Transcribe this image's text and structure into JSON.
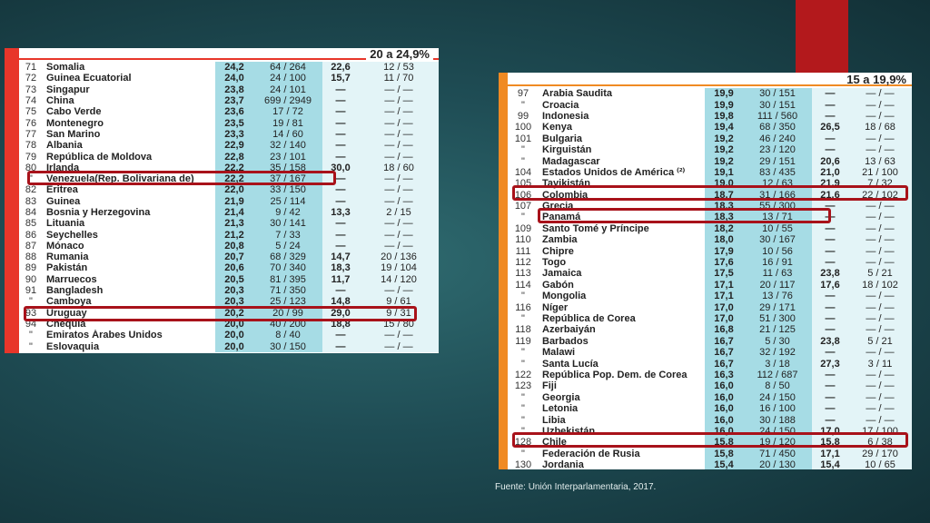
{
  "left_table": {
    "header": "20 a 24,9%",
    "rows": [
      {
        "rank": "71",
        "country": "Somalia",
        "pct": "24,2",
        "seats": "64 / 264",
        "pct2": "22,6",
        "seats2": "12 / 53"
      },
      {
        "rank": "72",
        "country": "Guinea Ecuatorial",
        "pct": "24,0",
        "seats": "24 / 100",
        "pct2": "15,7",
        "seats2": "11 / 70"
      },
      {
        "rank": "73",
        "country": "Singapur",
        "pct": "23,8",
        "seats": "24 / 101",
        "pct2": "—",
        "seats2": "— / —"
      },
      {
        "rank": "74",
        "country": "China",
        "pct": "23,7",
        "seats": "699 / 2949",
        "pct2": "—",
        "seats2": "— / —"
      },
      {
        "rank": "75",
        "country": "Cabo Verde",
        "pct": "23,6",
        "seats": "17 / 72",
        "pct2": "—",
        "seats2": "— / —"
      },
      {
        "rank": "76",
        "country": "Montenegro",
        "pct": "23,5",
        "seats": "19 / 81",
        "pct2": "—",
        "seats2": "— / —"
      },
      {
        "rank": "77",
        "country": "San Marino",
        "pct": "23,3",
        "seats": "14 / 60",
        "pct2": "—",
        "seats2": "— / —"
      },
      {
        "rank": "78",
        "country": "Albania",
        "pct": "22,9",
        "seats": "32 / 140",
        "pct2": "—",
        "seats2": "— / —"
      },
      {
        "rank": "79",
        "country": "República de Moldova",
        "pct": "22,8",
        "seats": "23 / 101",
        "pct2": "—",
        "seats2": "— / —"
      },
      {
        "rank": "80",
        "country": "Irlanda",
        "pct": "22,2",
        "seats": "35 / 158",
        "pct2": "30,0",
        "seats2": "18 / 60"
      },
      {
        "rank": "\"",
        "country": "Venezuela(Rep. Bolivariana de)",
        "pct": "22,2",
        "seats": "37 / 167",
        "pct2": "—",
        "seats2": "— / —"
      },
      {
        "rank": "82",
        "country": "Eritrea",
        "pct": "22,0",
        "seats": "33 / 150",
        "pct2": "—",
        "seats2": "— / —"
      },
      {
        "rank": "83",
        "country": "Guinea",
        "pct": "21,9",
        "seats": "25 / 114",
        "pct2": "—",
        "seats2": "— / —"
      },
      {
        "rank": "84",
        "country": "Bosnia y Herzegovina",
        "pct": "21,4",
        "seats": "9 / 42",
        "pct2": "13,3",
        "seats2": "2 / 15"
      },
      {
        "rank": "85",
        "country": "Lituania",
        "pct": "21,3",
        "seats": "30 / 141",
        "pct2": "—",
        "seats2": "— / —"
      },
      {
        "rank": "86",
        "country": "Seychelles",
        "pct": "21,2",
        "seats": "7 / 33",
        "pct2": "—",
        "seats2": "— / —"
      },
      {
        "rank": "87",
        "country": "Mónaco",
        "pct": "20,8",
        "seats": "5 / 24",
        "pct2": "—",
        "seats2": "— / —"
      },
      {
        "rank": "88",
        "country": "Rumania",
        "pct": "20,7",
        "seats": "68 / 329",
        "pct2": "14,7",
        "seats2": "20 / 136"
      },
      {
        "rank": "89",
        "country": "Pakistán",
        "pct": "20,6",
        "seats": "70 / 340",
        "pct2": "18,3",
        "seats2": "19 / 104"
      },
      {
        "rank": "90",
        "country": "Marruecos",
        "pct": "20,5",
        "seats": "81 / 395",
        "pct2": "11,7",
        "seats2": "14 / 120"
      },
      {
        "rank": "91",
        "country": "Bangladesh",
        "pct": "20,3",
        "seats": "71 / 350",
        "pct2": "—",
        "seats2": "— / —"
      },
      {
        "rank": "\"",
        "country": "Camboya",
        "pct": "20,3",
        "seats": "25 / 123",
        "pct2": "14,8",
        "seats2": "9 / 61"
      },
      {
        "rank": "93",
        "country": "Uruguay",
        "pct": "20,2",
        "seats": "20 / 99",
        "pct2": "29,0",
        "seats2": "9 / 31"
      },
      {
        "rank": "94",
        "country": "Chequia",
        "pct": "20,0",
        "seats": "40 / 200",
        "pct2": "18,8",
        "seats2": "15 / 80"
      },
      {
        "rank": "\"",
        "country": "Emiratos Árabes Unidos",
        "pct": "20,0",
        "seats": "8 / 40",
        "pct2": "—",
        "seats2": "— / —"
      },
      {
        "rank": "\"",
        "country": "Eslovaquia",
        "pct": "20,0",
        "seats": "30 / 150",
        "pct2": "—",
        "seats2": "— / —"
      }
    ]
  },
  "right_table": {
    "header": "15 a 19,9%",
    "rows": [
      {
        "rank": "97",
        "country": "Arabia Saudita",
        "pct": "19,9",
        "seats": "30 / 151",
        "pct2": "—",
        "seats2": "— / —"
      },
      {
        "rank": "\"",
        "country": "Croacia",
        "pct": "19,9",
        "seats": "30 / 151",
        "pct2": "—",
        "seats2": "— / —"
      },
      {
        "rank": "99",
        "country": "Indonesia",
        "pct": "19,8",
        "seats": "111 / 560",
        "pct2": "—",
        "seats2": "— / —"
      },
      {
        "rank": "100",
        "country": "Kenya",
        "pct": "19,4",
        "seats": "68 / 350",
        "pct2": "26,5",
        "seats2": "18 / 68"
      },
      {
        "rank": "101",
        "country": "Bulgaria",
        "pct": "19,2",
        "seats": "46 / 240",
        "pct2": "—",
        "seats2": "— / —"
      },
      {
        "rank": "\"",
        "country": "Kirguistán",
        "pct": "19,2",
        "seats": "23 / 120",
        "pct2": "—",
        "seats2": "— / —"
      },
      {
        "rank": "\"",
        "country": "Madagascar",
        "pct": "19,2",
        "seats": "29 / 151",
        "pct2": "20,6",
        "seats2": "13 / 63"
      },
      {
        "rank": "104",
        "country": "Estados Unidos de América ⁽²⁾",
        "pct": "19,1",
        "seats": "83 / 435",
        "pct2": "21,0",
        "seats2": "21 / 100"
      },
      {
        "rank": "105",
        "country": "Tayikistán",
        "pct": "19,0",
        "seats": "12 / 63",
        "pct2": "21,9",
        "seats2": "7 / 32"
      },
      {
        "rank": "106",
        "country": "Colombia",
        "pct": "18,7",
        "seats": "31 / 166",
        "pct2": "21,6",
        "seats2": "22 / 102"
      },
      {
        "rank": "107",
        "country": "Grecia",
        "pct": "18,3",
        "seats": "55 / 300",
        "pct2": "—",
        "seats2": "— / —"
      },
      {
        "rank": "\"",
        "country": "Panamá",
        "pct": "18,3",
        "seats": "13 / 71",
        "pct2": "—",
        "seats2": "— / —"
      },
      {
        "rank": "109",
        "country": "Santo Tomé y Príncipe",
        "pct": "18,2",
        "seats": "10 / 55",
        "pct2": "—",
        "seats2": "— / —"
      },
      {
        "rank": "110",
        "country": "Zambia",
        "pct": "18,0",
        "seats": "30 / 167",
        "pct2": "—",
        "seats2": "— / —"
      },
      {
        "rank": "111",
        "country": "Chipre",
        "pct": "17,9",
        "seats": "10 / 56",
        "pct2": "—",
        "seats2": "— / —"
      },
      {
        "rank": "112",
        "country": "Togo",
        "pct": "17,6",
        "seats": "16 / 91",
        "pct2": "—",
        "seats2": "— / —"
      },
      {
        "rank": "113",
        "country": "Jamaica",
        "pct": "17,5",
        "seats": "11 / 63",
        "pct2": "23,8",
        "seats2": "5 / 21"
      },
      {
        "rank": "114",
        "country": "Gabón",
        "pct": "17,1",
        "seats": "20 / 117",
        "pct2": "17,6",
        "seats2": "18 / 102"
      },
      {
        "rank": "\"",
        "country": "Mongolia",
        "pct": "17,1",
        "seats": "13 / 76",
        "pct2": "—",
        "seats2": "— / —"
      },
      {
        "rank": "116",
        "country": "Níger",
        "pct": "17,0",
        "seats": "29 / 171",
        "pct2": "—",
        "seats2": "— / —"
      },
      {
        "rank": "\"",
        "country": "República de Corea",
        "pct": "17,0",
        "seats": "51 / 300",
        "pct2": "—",
        "seats2": "— / —"
      },
      {
        "rank": "118",
        "country": "Azerbaiyán",
        "pct": "16,8",
        "seats": "21 / 125",
        "pct2": "—",
        "seats2": "— / —"
      },
      {
        "rank": "119",
        "country": "Barbados",
        "pct": "16,7",
        "seats": "5 / 30",
        "pct2": "23,8",
        "seats2": "5 / 21"
      },
      {
        "rank": "\"",
        "country": "Malawi",
        "pct": "16,7",
        "seats": "32 / 192",
        "pct2": "—",
        "seats2": "— / —"
      },
      {
        "rank": "\"",
        "country": "Santa Lucía",
        "pct": "16,7",
        "seats": "3 / 18",
        "pct2": "27,3",
        "seats2": "3 / 11"
      },
      {
        "rank": "122",
        "country": "República Pop. Dem. de Corea",
        "pct": "16,3",
        "seats": "112 / 687",
        "pct2": "—",
        "seats2": "— / —"
      },
      {
        "rank": "123",
        "country": "Fiji",
        "pct": "16,0",
        "seats": "8 / 50",
        "pct2": "—",
        "seats2": "— / —"
      },
      {
        "rank": "\"",
        "country": "Georgia",
        "pct": "16,0",
        "seats": "24 / 150",
        "pct2": "—",
        "seats2": "— / —"
      },
      {
        "rank": "\"",
        "country": "Letonia",
        "pct": "16,0",
        "seats": "16 / 100",
        "pct2": "—",
        "seats2": "— / —"
      },
      {
        "rank": "\"",
        "country": "Libia",
        "pct": "16,0",
        "seats": "30 / 188",
        "pct2": "—",
        "seats2": "— / —"
      },
      {
        "rank": "\"",
        "country": "Uzbekistán",
        "pct": "16,0",
        "seats": "24 / 150",
        "pct2": "17,0",
        "seats2": "17 / 100"
      },
      {
        "rank": "128",
        "country": "Chile",
        "pct": "15,8",
        "seats": "19 / 120",
        "pct2": "15,8",
        "seats2": "6 / 38"
      },
      {
        "rank": "\"",
        "country": "Federación de Rusia",
        "pct": "15,8",
        "seats": "71 / 450",
        "pct2": "17,1",
        "seats2": "29 / 170"
      },
      {
        "rank": "130",
        "country": "Jordania",
        "pct": "15,4",
        "seats": "20 / 130",
        "pct2": "15,4",
        "seats2": "10 / 65"
      }
    ]
  },
  "source": "Fuente: Unión Interparlamentaria, 2017.",
  "colors": {
    "background": "#1f4d55",
    "accent_red": "#b3191c",
    "left_stripe": "#e8362a",
    "right_stripe": "#f08a23",
    "cell_blue": "#a6dce5",
    "highlight": "#a8121a"
  }
}
